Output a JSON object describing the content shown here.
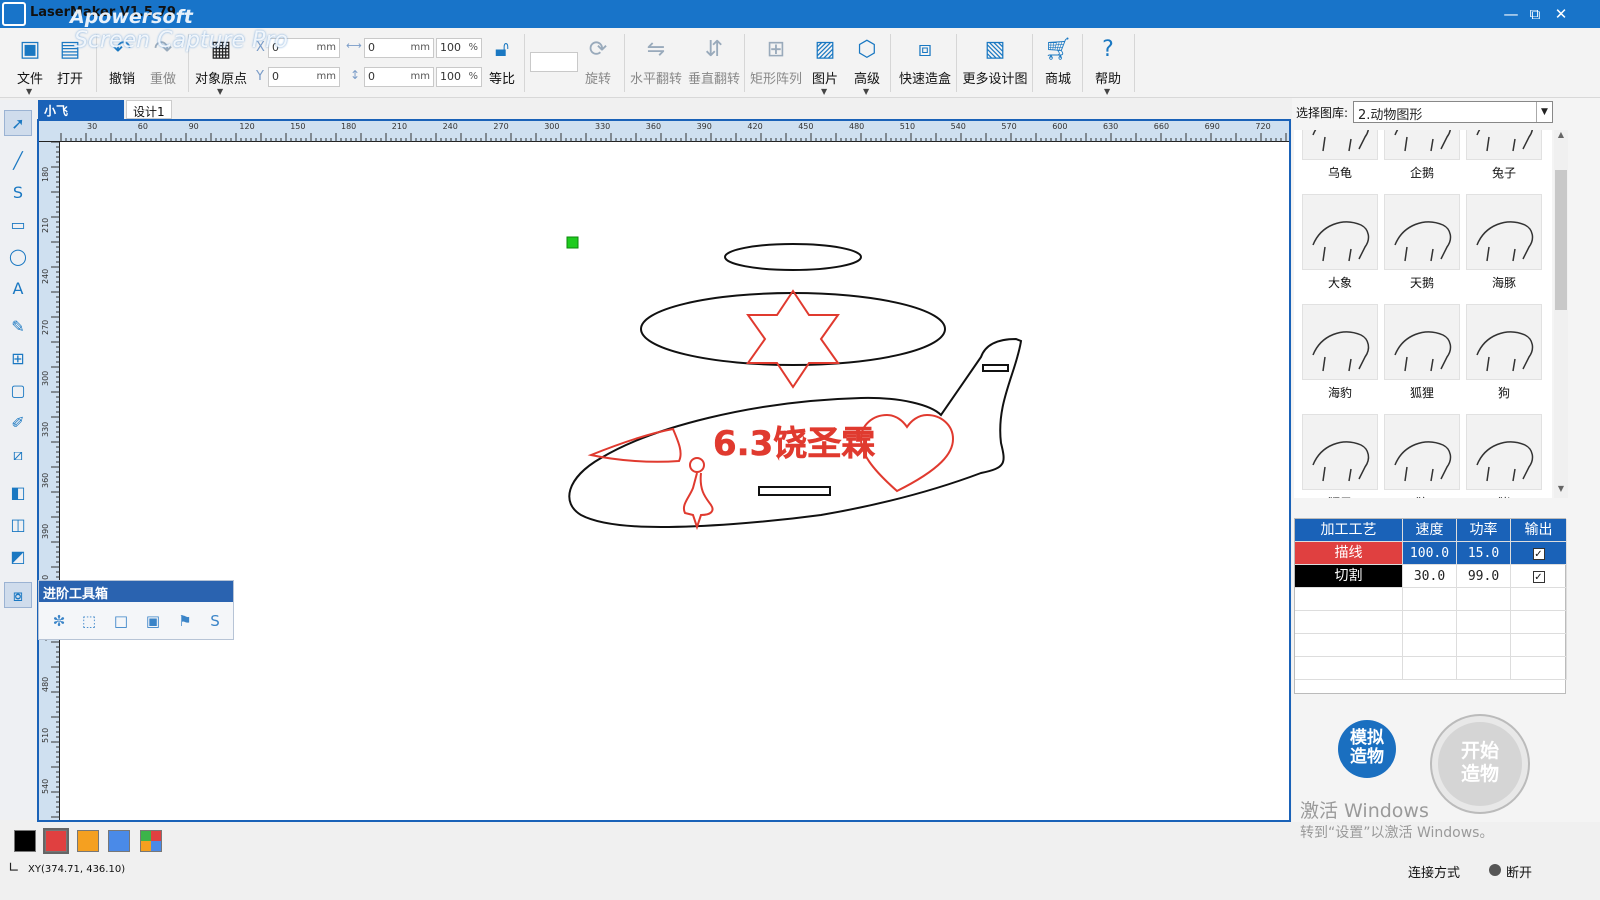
{
  "window": {
    "title": "LaserMaker V1.5.79",
    "watermark_brand": "Apowersoft",
    "watermark_product": "Screen Capture Pro",
    "controls": [
      "—",
      "⧉",
      "✕"
    ]
  },
  "toolbar": {
    "file": "文件",
    "open": "打开",
    "undo": "撤销",
    "redo": "重做",
    "origin": "对象原点",
    "x_label": "X",
    "y_label": "Y",
    "x_value": "0",
    "y_value": "0",
    "unit_mm": "mm",
    "width_value": "0",
    "height_value": "0",
    "scale_w": "100",
    "scale_h": "100",
    "percent": "%",
    "proportional": "等比",
    "rotate": "旋转",
    "flip_h": "水平翻转",
    "flip_v": "垂直翻转",
    "array": "矩形阵列",
    "image": "图片",
    "advanced": "高级",
    "quick_box": "快速造盒",
    "more_designs": "更多设计图",
    "shop": "商城",
    "help": "帮助"
  },
  "tabs": [
    {
      "label": "小飞机.lcp",
      "close": "✕"
    },
    {
      "label": "设计1"
    }
  ],
  "rulers": {
    "top": [
      "30",
      "60",
      "90",
      "120",
      "150",
      "180",
      "210",
      "240",
      "270",
      "300",
      "330",
      "360",
      "390",
      "420",
      "450",
      "480",
      "510",
      "540",
      "570",
      "600",
      "630",
      "660",
      "690",
      "720"
    ],
    "left": [
      "180",
      "210",
      "240",
      "270",
      "300",
      "330",
      "360",
      "390",
      "420",
      "450",
      "480",
      "510",
      "540"
    ]
  },
  "drawing": {
    "text": "6.3饶圣霖",
    "stroke_black": "#111111",
    "stroke_red": "#e03a2f",
    "marker_color": "#1ecb1e"
  },
  "advanced_toolbox": {
    "title": "进阶工具箱"
  },
  "library": {
    "label": "选择图库:",
    "selected": "2.动物图形",
    "items": [
      "乌龟",
      "企鹅",
      "兔子",
      "大象",
      "天鹅",
      "海豚",
      "海豹",
      "狐狸",
      "狗",
      "狮子",
      "狼",
      "猪"
    ]
  },
  "process_table": {
    "headers": [
      "加工工艺",
      "速度",
      "功率",
      "输出"
    ],
    "rows": [
      {
        "name": "描线",
        "speed": "100.0",
        "power": "15.0",
        "output": "✓",
        "color": "#e04040"
      },
      {
        "name": "切割",
        "speed": "30.0",
        "power": "99.0",
        "output": "✓",
        "color": "#000000"
      }
    ]
  },
  "buttons": {
    "simulate": "模拟造物",
    "start": "开始造物"
  },
  "activation": {
    "line1": "激活 Windows",
    "line2": "转到“设置”以激活 Windows。"
  },
  "palette": [
    "#000000",
    "#e04040",
    "#f5a020",
    "#4a8ae8"
  ],
  "status": {
    "xy": "XY(374.71, 436.10)",
    "connection_label": "连接方式",
    "connection_state": "断开"
  }
}
